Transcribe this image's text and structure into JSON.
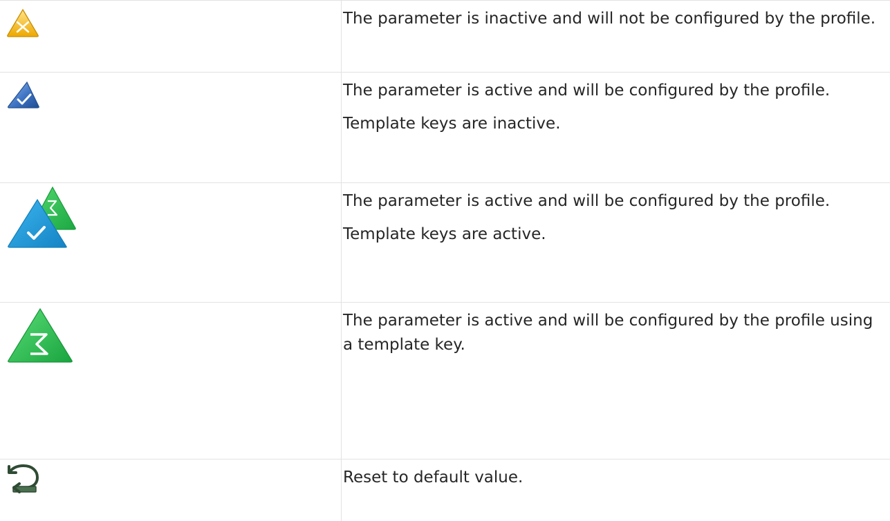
{
  "legend_rows": [
    {
      "icon": "inactive-warning-x-icon",
      "icon_color": "#f2b81f",
      "paragraphs": [
        "The parameter is inactive and will not be configured by the profile."
      ]
    },
    {
      "icon": "active-check-icon",
      "icon_color": "#2f63b2",
      "paragraphs": [
        "The parameter is active and will be configured by the profile.",
        "Template keys are inactive."
      ]
    },
    {
      "icon": "active-check-with-template-sigma-icon",
      "icon_color": "#1896d8",
      "icon_secondary_color": "#35c45a",
      "paragraphs": [
        "The parameter is active and will be configured by the profile.",
        "Template keys are active."
      ]
    },
    {
      "icon": "template-key-sigma-icon",
      "icon_color": "#2fbd52",
      "paragraphs": [
        "The parameter is active and will be configured by the profile using a template key."
      ]
    },
    {
      "icon": "reset-default-icon",
      "icon_color": "#3f5f42",
      "paragraphs": [
        "Reset to default value."
      ]
    }
  ]
}
